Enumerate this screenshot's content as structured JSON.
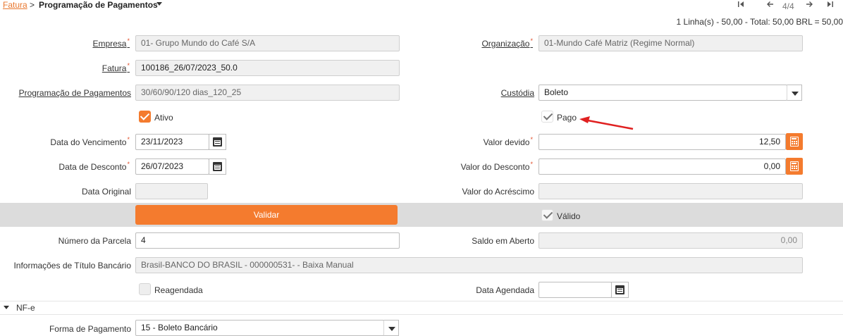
{
  "breadcrumb": {
    "parent": "Fatura",
    "separator": ">",
    "current": "Programação de Pagamentos"
  },
  "pager": {
    "text": "4/4",
    "first_icon": "first-page-icon",
    "prev_icon": "arrow-left-icon",
    "next_icon": "arrow-right-icon",
    "last_icon": "last-page-icon"
  },
  "summary": "1 Linha(s) - 50,00 - Total: 50,00 BRL = 50,00",
  "fields": {
    "empresa": {
      "label": "Empresa",
      "value": "01- Grupo Mundo do Café S/A"
    },
    "organizacao": {
      "label": "Organização",
      "value": "01-Mundo Café Matriz (Regime Normal)"
    },
    "fatura": {
      "label": "Fatura",
      "value": "100186_26/07/2023_50.0"
    },
    "programacao": {
      "label": "Programação de Pagamentos",
      "value": "30/60/90/120 dias_120_25"
    },
    "custodia": {
      "label": "Custódia",
      "value": "Boleto"
    },
    "ativo": {
      "label": "Ativo",
      "checked": true
    },
    "pago": {
      "label": "Pago",
      "checked": true
    },
    "data_vencimento": {
      "label": "Data do Vencimento",
      "value": "23/11/2023"
    },
    "valor_devido": {
      "label": "Valor devido",
      "value": "12,50"
    },
    "data_desconto": {
      "label": "Data de Desconto",
      "value": "26/07/2023"
    },
    "valor_desconto": {
      "label": "Valor do Desconto",
      "value": "0,00"
    },
    "data_original": {
      "label": "Data Original",
      "value": ""
    },
    "valor_acrescimo": {
      "label": "Valor do Acréscimo",
      "value": ""
    },
    "validar": {
      "label": "Validar"
    },
    "valido": {
      "label": "Válido",
      "checked": true
    },
    "numero_parcela": {
      "label": "Número da Parcela",
      "value": "4"
    },
    "saldo_aberto": {
      "label": "Saldo em Aberto",
      "value": "0,00"
    },
    "info_titulo": {
      "label": "Informações de Título Bancário",
      "value": "Brasil-BANCO DO BRASIL - 000000531- - Baixa Manual"
    },
    "reagendada": {
      "label": "Reagendada",
      "checked": false
    },
    "data_agendada": {
      "label": "Data Agendada",
      "value": ""
    },
    "forma_pagamento": {
      "label": "Forma de Pagamento",
      "value": "15 - Boleto Bancário"
    }
  },
  "section": {
    "title": "NF-e"
  },
  "required_mark": "*",
  "colors": {
    "accent": "#f47b2e",
    "link": "#e8772e",
    "required": "#e04e2b",
    "annotation_arrow": "#e02020"
  }
}
